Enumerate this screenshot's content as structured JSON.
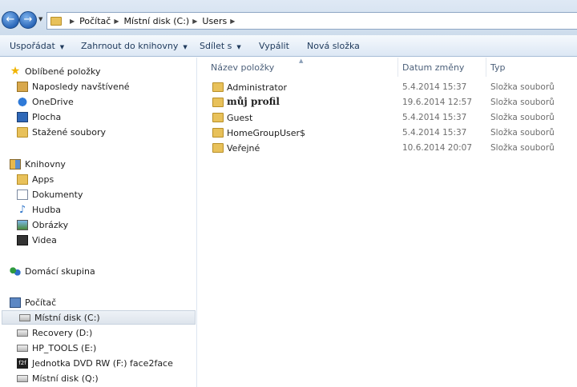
{
  "address": {
    "breadcrumbs": [
      "Počítač",
      "Místní disk (C:)",
      "Users"
    ]
  },
  "toolbar": {
    "items": [
      {
        "label": "Uspořádat",
        "has_menu": true
      },
      {
        "label": "Zahrnout do knihovny",
        "has_menu": true
      },
      {
        "label": "Sdílet s",
        "has_menu": true
      },
      {
        "label": "Vypálit",
        "has_menu": false
      },
      {
        "label": "Nová složka",
        "has_menu": false
      }
    ]
  },
  "nav": {
    "favorites": {
      "title": "Oblíbené položky",
      "items": [
        "Naposledy navštívené",
        "OneDrive",
        "Plocha",
        "Stažené soubory"
      ]
    },
    "libraries": {
      "title": "Knihovny",
      "items": [
        "Apps",
        "Dokumenty",
        "Hudba",
        "Obrázky",
        "Videa"
      ]
    },
    "homegroup": "Domácí skupina",
    "computer": {
      "title": "Počítač",
      "items": [
        "Místní disk (C:)",
        "Recovery (D:)",
        "HP_TOOLS (E:)",
        "Jednotka DVD RW (F:) face2face",
        "Místní disk (Q:)"
      ],
      "selected_index": 0,
      "dvd_badge": "f2f"
    }
  },
  "columns": {
    "name": "Název položky",
    "date": "Datum změny",
    "type": "Typ"
  },
  "files": [
    {
      "name": "Administrator",
      "date": "5.4.2014 15:37",
      "type": "Složka souborů"
    },
    {
      "name": "můj profil",
      "date": "19.6.2014 12:57",
      "type": "Složka souborů"
    },
    {
      "name": "Guest",
      "date": "5.4.2014 15:37",
      "type": "Složka souborů"
    },
    {
      "name": "HomeGroupUser$",
      "date": "5.4.2014 15:37",
      "type": "Složka souborů"
    },
    {
      "name": "Veřejné",
      "date": "10.6.2014 20:07",
      "type": "Složka souborů"
    }
  ]
}
